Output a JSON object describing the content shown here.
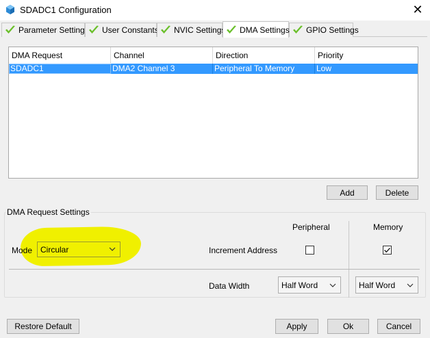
{
  "window": {
    "title": "SDADC1 Configuration",
    "close_glyph": "✕",
    "icon": "cube-icon"
  },
  "tabs": [
    {
      "label": "Parameter Settings",
      "active": false
    },
    {
      "label": "User Constants",
      "active": false
    },
    {
      "label": "NVIC Settings",
      "active": false
    },
    {
      "label": "DMA Settings",
      "active": true
    },
    {
      "label": "GPIO Settings",
      "active": false
    }
  ],
  "colors": {
    "check": "#6abf2a",
    "selection": "#3399ff",
    "highlight": "#f0f000"
  },
  "table": {
    "columns": [
      "DMA Request",
      "Channel",
      "Direction",
      "Priority"
    ],
    "rows": [
      [
        "SDADC1",
        "DMA2 Channel 3",
        "Peripheral To Memory",
        "Low"
      ]
    ],
    "selected_row": 0
  },
  "table_buttons": {
    "add": "Add",
    "delete": "Delete"
  },
  "request_settings": {
    "group_label": "DMA Request Settings",
    "mode_label": "Mode",
    "mode_value": "Circular",
    "peripheral_header": "Peripheral",
    "memory_header": "Memory",
    "increment_label": "Increment Address",
    "peripheral_increment": false,
    "memory_increment": true,
    "data_width_label": "Data Width",
    "peripheral_width": "Half Word",
    "memory_width": "Half Word"
  },
  "footer": {
    "restore": "Restore Default",
    "apply": "Apply",
    "ok": "Ok",
    "cancel": "Cancel"
  }
}
